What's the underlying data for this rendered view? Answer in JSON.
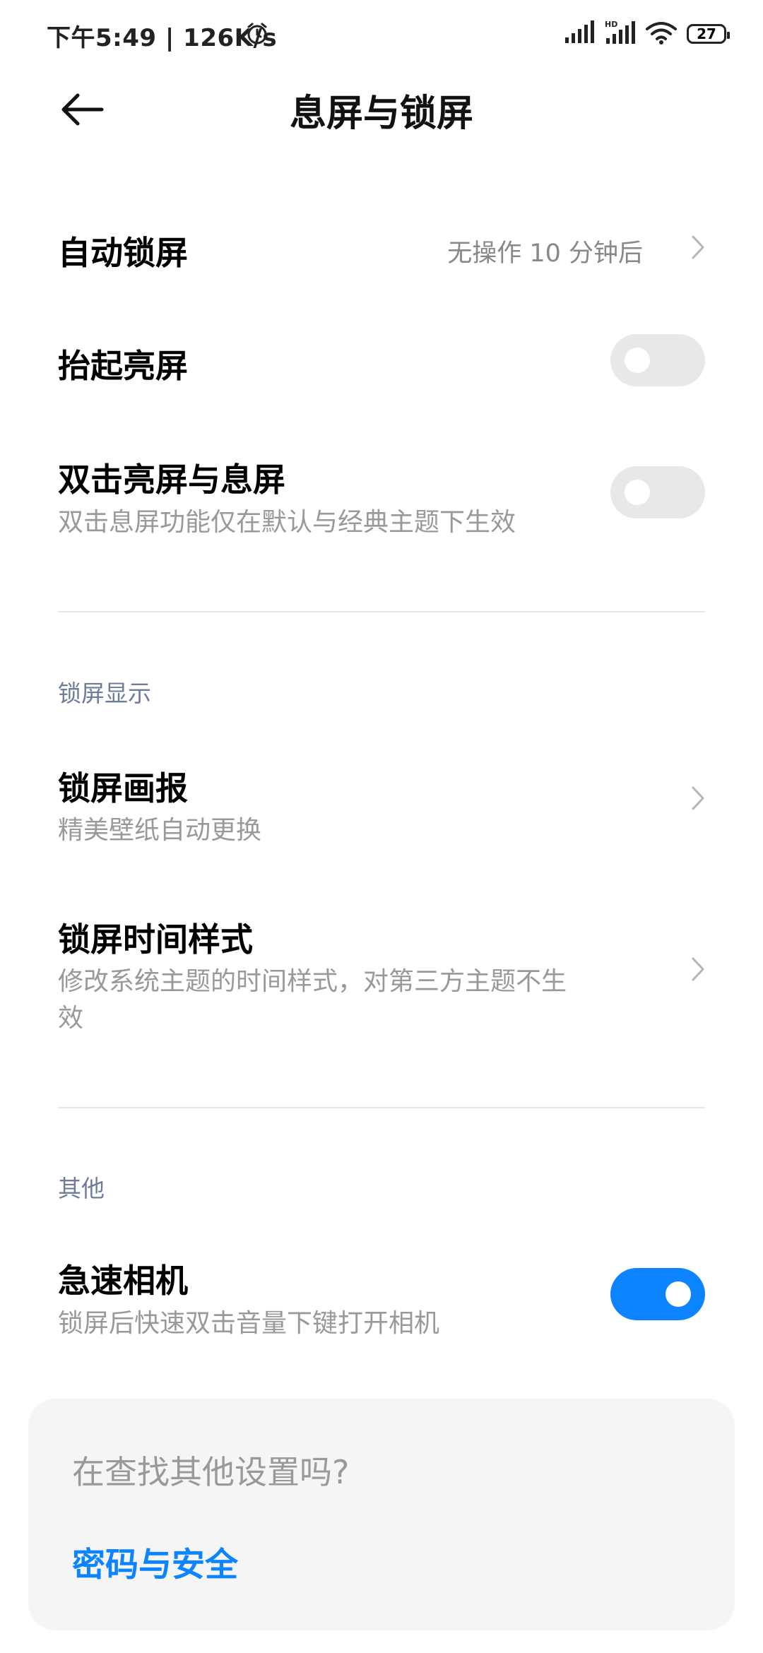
{
  "status_bar": {
    "time": "下午5:49 | 126K/s",
    "battery": "27"
  },
  "header": {
    "title": "息屏与锁屏"
  },
  "settings": {
    "auto_lock": {
      "label": "自动锁屏",
      "value": "无操作 10 分钟后"
    },
    "raise_to_wake": {
      "label": "抬起亮屏",
      "enabled": false
    },
    "double_tap": {
      "label": "双击亮屏与息屏",
      "sub": "双击息屏功能仅在默认与经典主题下生效",
      "enabled": false
    }
  },
  "lock_display": {
    "section_title": "锁屏显示",
    "wallpaper": {
      "label": "锁屏画报",
      "sub": "精美壁纸自动更换"
    },
    "clock_style": {
      "label": "锁屏时间样式",
      "sub_line1": "修改系统主题的时间样式，对第三方主题不生",
      "sub_line2": "效"
    }
  },
  "others": {
    "section_title": "其他",
    "quick_camera": {
      "label": "急速相机",
      "sub": "锁屏后快速双击音量下键打开相机",
      "enabled": true
    }
  },
  "footer_card": {
    "question": "在查找其他设置吗?",
    "link": "密码与安全"
  },
  "colors": {
    "accent": "#0d84ff",
    "toggle_off": "#e8e8e8",
    "section_text": "#6f7c99"
  },
  "icons": [
    "alarm-icon",
    "signal-icon",
    "hd-signal-icon",
    "wifi-icon",
    "battery-icon",
    "back-arrow-icon",
    "chevron-right-icon"
  ]
}
